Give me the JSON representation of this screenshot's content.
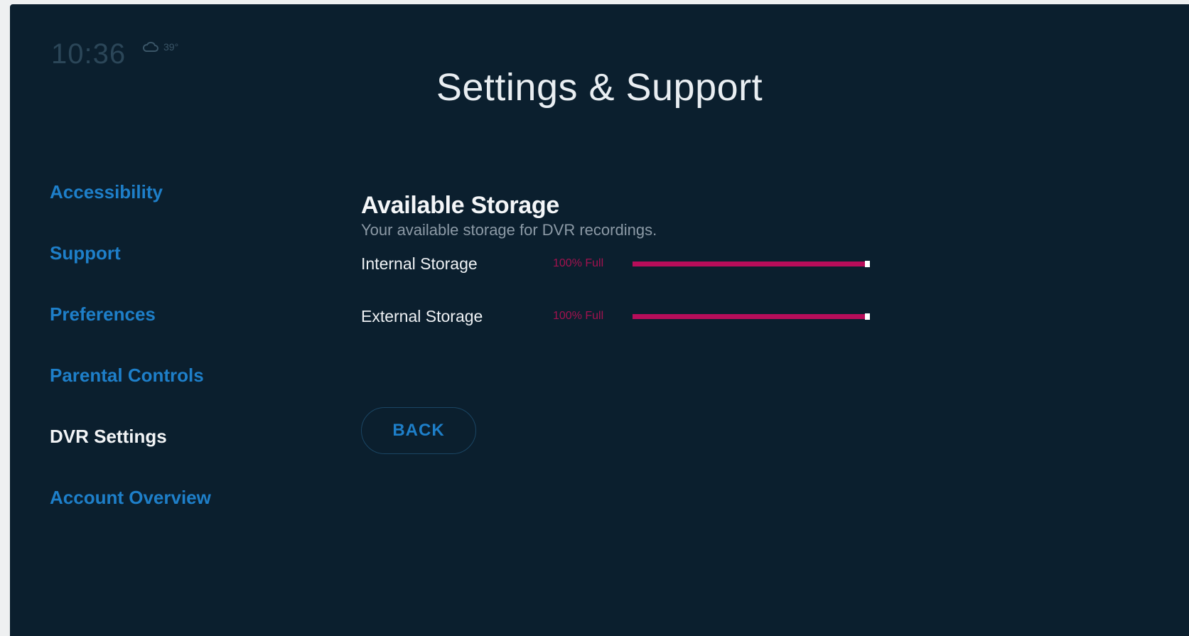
{
  "header": {
    "time": "10:36",
    "weather_icon": "cloud-icon",
    "temperature": "39°",
    "title": "Settings & Support"
  },
  "sidebar": {
    "items": [
      {
        "label": "Accessibility",
        "active": false
      },
      {
        "label": "Support",
        "active": false
      },
      {
        "label": "Preferences",
        "active": false
      },
      {
        "label": "Parental Controls",
        "active": false
      },
      {
        "label": "DVR Settings",
        "active": true
      },
      {
        "label": "Account Overview",
        "active": false
      }
    ]
  },
  "main": {
    "title": "Available Storage",
    "description": "Your available storage for DVR recordings.",
    "storage": [
      {
        "label": "Internal Storage",
        "percent_text": "100% Full",
        "fill_fraction": 1.0
      },
      {
        "label": "External Storage",
        "percent_text": "100% Full",
        "fill_fraction": 1.0
      }
    ],
    "back_label": "BACK"
  },
  "colors": {
    "background": "#0b1f2e",
    "accent_blue": "#1e7fc9",
    "storage_bar": "#b80d5a",
    "active_text": "#f2f4f6"
  }
}
